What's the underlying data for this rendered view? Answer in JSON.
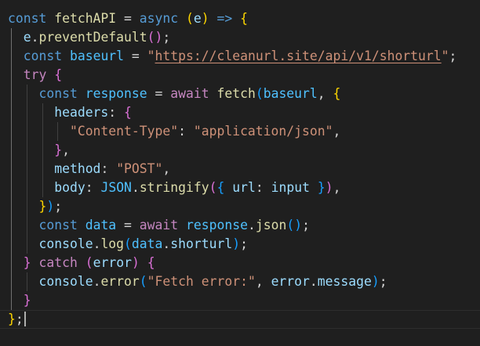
{
  "code": {
    "l1": {
      "const": "const",
      "name": "fetchAPI",
      "eq": " = ",
      "async": "async",
      "sp": " ",
      "po": "(",
      "param": "e",
      "pc": ")",
      "arrow": " => ",
      "brace": "{"
    },
    "l2": {
      "obj": "e",
      "dot": ".",
      "fn": "preventDefault",
      "po": "(",
      "pc": ")",
      "semi": ";"
    },
    "l3": {
      "const": "const",
      "name": "baseurl",
      "eq": " = ",
      "q1": "\"",
      "url": "https://cleanurl.site/api/v1/shorturl",
      "q2": "\"",
      "semi": ";"
    },
    "l4": {
      "try": "try",
      "brace": "{"
    },
    "l5": {
      "const": "const",
      "name": "response",
      "eq": " = ",
      "await": "await",
      "fn": "fetch",
      "po": "(",
      "arg": "baseurl",
      "comma": ", ",
      "brace": "{"
    },
    "l6": {
      "key": "headers",
      "colon": ": ",
      "brace": "{"
    },
    "l7": {
      "key": "\"Content-Type\"",
      "colon": ": ",
      "val": "\"application/json\"",
      "comma": ","
    },
    "l8": {
      "brace": "}",
      "comma": ","
    },
    "l9": {
      "key": "method",
      "colon": ": ",
      "val": "\"POST\"",
      "comma": ","
    },
    "l10": {
      "key": "body",
      "colon": ": ",
      "obj": "JSON",
      "dot": ".",
      "fn": "stringify",
      "po": "(",
      "bo": "{",
      "k2": " url",
      "c2": ": ",
      "v2": "input",
      "bc": " }",
      "pc": ")",
      "comma": ","
    },
    "l11": {
      "brace": "}",
      "pc": ")",
      "semi": ";"
    },
    "l12": {
      "const": "const",
      "name": "data",
      "eq": " = ",
      "await": "await",
      "obj": "response",
      "dot": ".",
      "fn": "json",
      "po": "(",
      "pc": ")",
      "semi": ";"
    },
    "l13": {
      "obj": "console",
      "dot": ".",
      "fn": "log",
      "po": "(",
      "arg": "data",
      "dot2": ".",
      "prop": "shorturl",
      "pc": ")",
      "semi": ";"
    },
    "l14": {
      "bc": "}",
      "catch": " catch",
      "sp": " ",
      "po": "(",
      "param": "error",
      "pc": ")",
      "sp2": " ",
      "bo": "{"
    },
    "l15": {
      "obj": "console",
      "dot": ".",
      "fn": "error",
      "po": "(",
      "str": "\"Fetch error:\"",
      "comma": ", ",
      "arg": "error",
      "dot2": ".",
      "prop": "message",
      "pc": ")",
      "semi": ";"
    },
    "l16": {
      "brace": "}"
    },
    "l17": {
      "brace": "}",
      "semi": ";"
    }
  }
}
